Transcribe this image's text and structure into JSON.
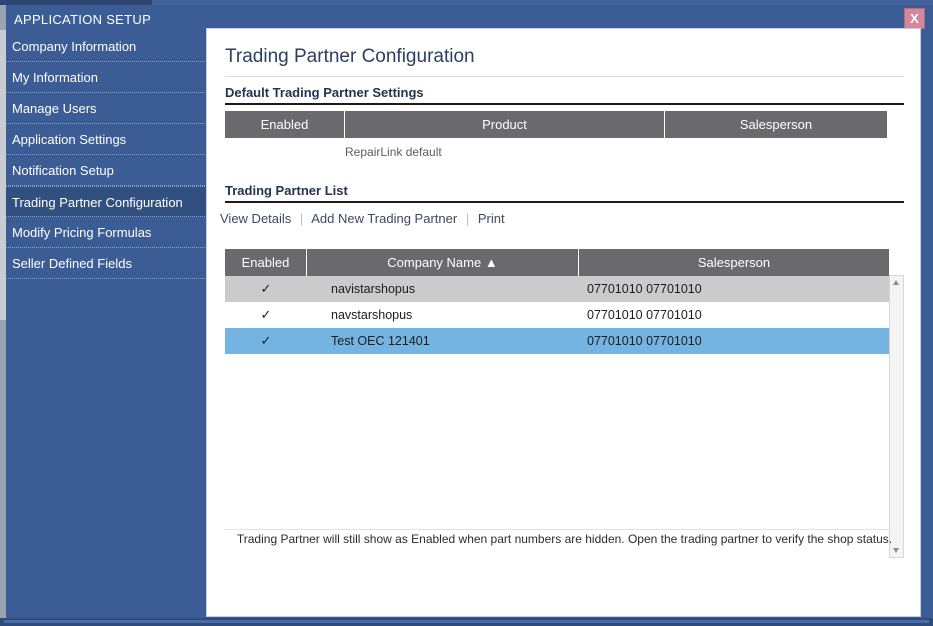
{
  "window": {
    "title": "APPLICATION SETUP",
    "close_label": "X",
    "close_icon": "close-icon",
    "accent_blue": "#3b5c94",
    "selected_row_blue": "#74b4e3",
    "close_button_color": "#d4869a"
  },
  "sidebar": {
    "items": [
      {
        "label": "Company Information",
        "selected": false
      },
      {
        "label": "My Information",
        "selected": false
      },
      {
        "label": "Manage Users",
        "selected": false
      },
      {
        "label": "Application Settings",
        "selected": false
      },
      {
        "label": "Notification Setup",
        "selected": false
      },
      {
        "label": "Trading Partner Configuration",
        "selected": true
      },
      {
        "label": "Modify Pricing Formulas",
        "selected": false
      },
      {
        "label": "Seller Defined Fields",
        "selected": false
      }
    ]
  },
  "main": {
    "page_title": "Trading Partner Configuration",
    "default_section": {
      "heading": "Default Trading Partner Settings",
      "columns": [
        "Enabled",
        "Product",
        "Salesperson"
      ],
      "rows": [
        {
          "enabled": "",
          "product": "RepairLink default",
          "salesperson": ""
        }
      ]
    },
    "list_section": {
      "heading": "Trading Partner List",
      "actions": [
        {
          "label": "View Details"
        },
        {
          "label": "Add New Trading Partner"
        },
        {
          "label": "Print"
        }
      ],
      "separator": "|",
      "columns": [
        "Enabled",
        "Company Name ▲",
        "Salesperson"
      ],
      "sort_column": "Company Name",
      "sort_direction": "ascending",
      "check_glyph": "✓",
      "rows": [
        {
          "enabled": "✓",
          "company": "navistarshopus",
          "salesperson": "07701010 07701010",
          "style": "alt"
        },
        {
          "enabled": "✓",
          "company": "navstarshopus",
          "salesperson": "07701010 07701010",
          "style": "plain"
        },
        {
          "enabled": "✓",
          "company": "Test OEC 121401",
          "salesperson": "07701010 07701010",
          "style": "sel"
        }
      ]
    },
    "footer_note": "Trading Partner will still show as Enabled when part numbers are hidden. Open the trading partner to verify the shop status."
  },
  "scrollbar": {
    "up_icon": "chevron-up-icon",
    "down_icon": "chevron-down-icon"
  }
}
